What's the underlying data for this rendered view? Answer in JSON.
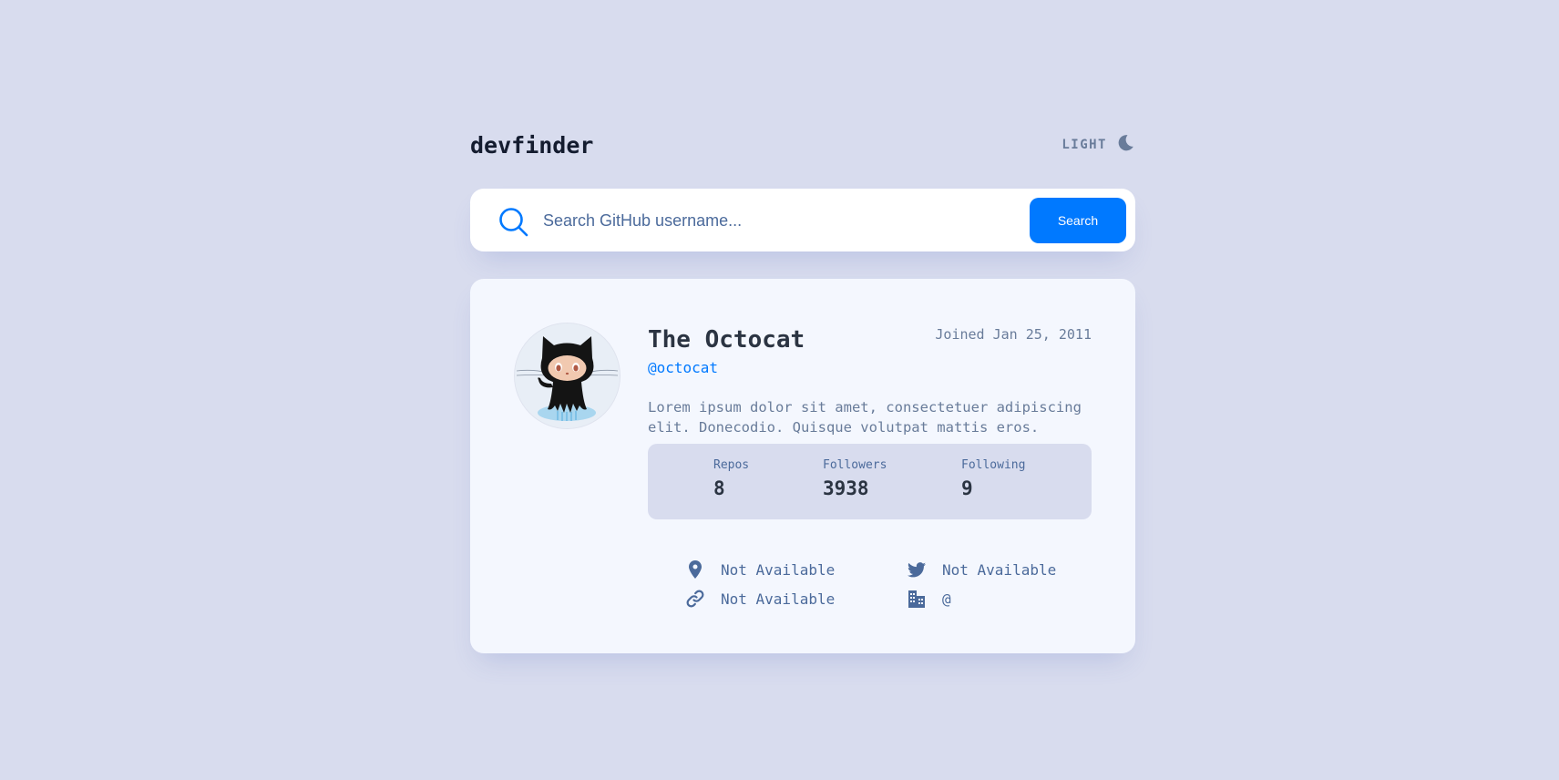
{
  "header": {
    "logo": "devfinder",
    "theme_label": "LIGHT",
    "theme_icon": "moon-icon"
  },
  "search": {
    "placeholder": "Search GitHub username...",
    "value": "",
    "button_label": "Search",
    "icon": "search-icon"
  },
  "profile": {
    "name": "The Octocat",
    "login": "@octocat",
    "joined": "Joined Jan 25, 2011",
    "bio": "Lorem ipsum dolor sit amet, consectetuer adipiscing elit. Donecodio. Quisque volutpat mattis eros.",
    "avatar": "octocat-avatar"
  },
  "stats": {
    "repos_label": "Repos",
    "repos_value": "8",
    "followers_label": "Followers",
    "followers_value": "3938",
    "following_label": "Following",
    "following_value": "9"
  },
  "links": {
    "location": {
      "icon": "location-pin-icon",
      "text": "Not Available"
    },
    "twitter": {
      "icon": "twitter-icon",
      "text": "Not Available"
    },
    "blog": {
      "icon": "link-icon",
      "text": "Not Available"
    },
    "company": {
      "icon": "company-building-icon",
      "text": "@"
    }
  },
  "colors": {
    "accent": "#0079ff",
    "background": "#d8dcee",
    "card": "#f4f7fe",
    "text_dark": "#2b3442",
    "text_muted": "#697c9a",
    "icon": "#4b6a9b"
  }
}
